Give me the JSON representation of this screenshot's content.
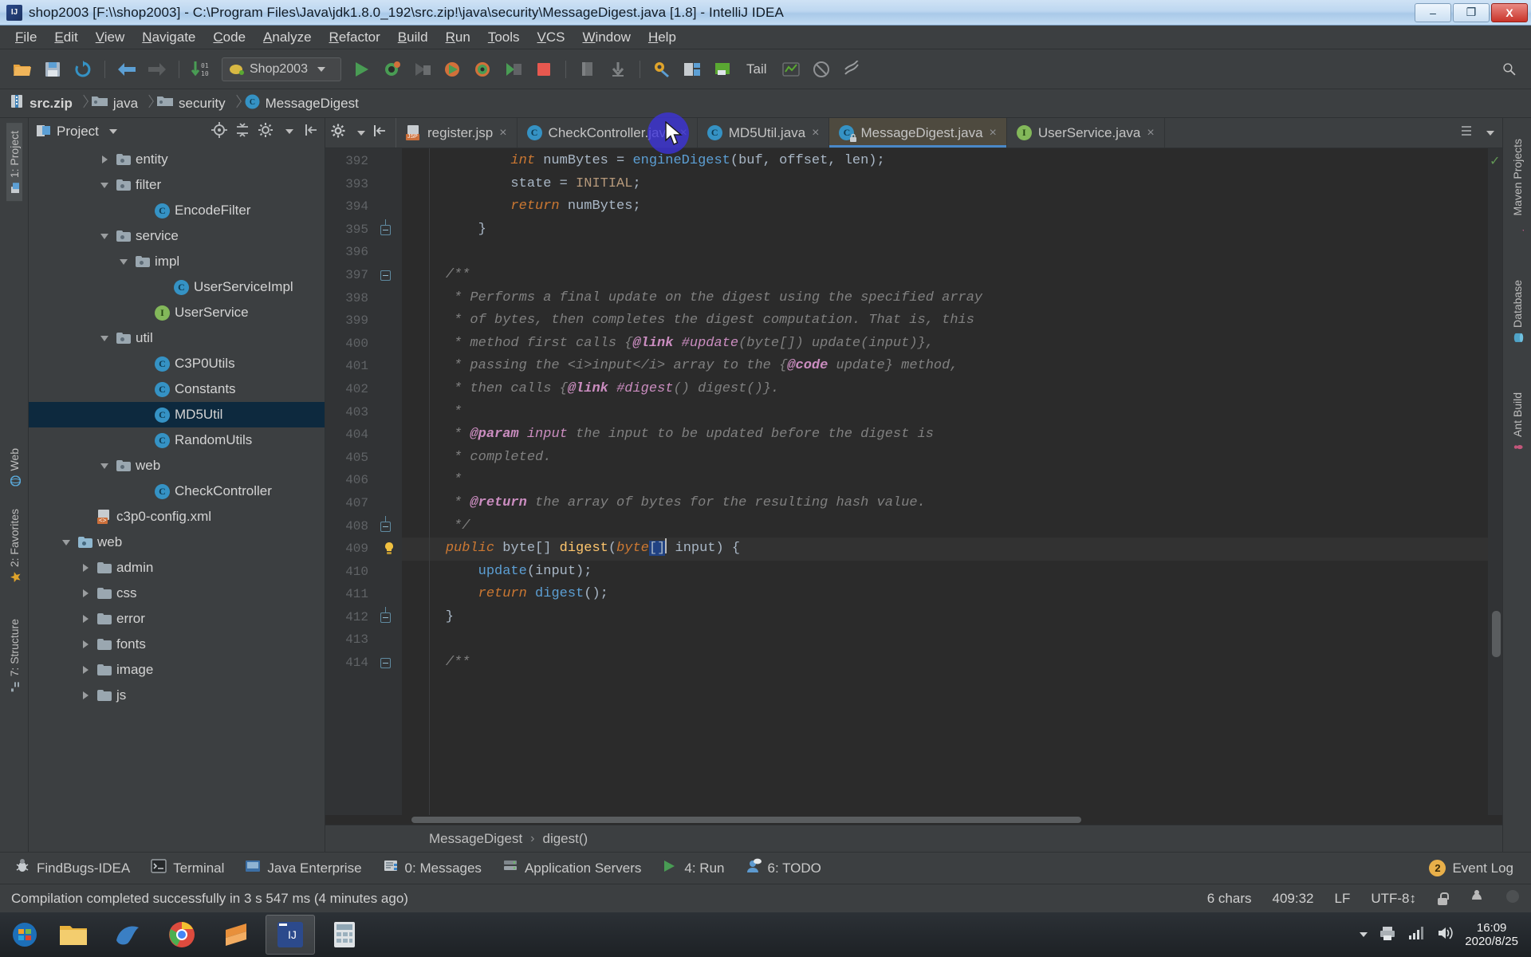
{
  "window": {
    "title": "shop2003 [F:\\\\shop2003] - C:\\Program Files\\Java\\jdk1.8.0_192\\src.zip!\\java\\security\\MessageDigest.java [1.8] - IntelliJ IDEA",
    "minimize_label": "–",
    "maximize_label": "❐",
    "close_label": "X"
  },
  "menubar": {
    "items": [
      {
        "label": "File",
        "mnemonic": "F"
      },
      {
        "label": "Edit",
        "mnemonic": "E"
      },
      {
        "label": "View",
        "mnemonic": "V"
      },
      {
        "label": "Navigate",
        "mnemonic": "N"
      },
      {
        "label": "Code",
        "mnemonic": "C"
      },
      {
        "label": "Analyze",
        "mnemonic": "A"
      },
      {
        "label": "Refactor",
        "mnemonic": "R"
      },
      {
        "label": "Build",
        "mnemonic": "B"
      },
      {
        "label": "Run",
        "mnemonic": "R"
      },
      {
        "label": "Tools",
        "mnemonic": "T"
      },
      {
        "label": "VCS",
        "mnemonic": "V"
      },
      {
        "label": "Window",
        "mnemonic": "W"
      },
      {
        "label": "Help",
        "mnemonic": "H"
      }
    ]
  },
  "toolbar": {
    "run_config": "Shop2003",
    "tail_label": "Tail",
    "icons": [
      "open-project-icon",
      "save-all-icon",
      "sync-icon",
      "back-icon",
      "forward-icon",
      "compile-icon",
      "run-icon",
      "debug-icon",
      "run-with-coverage-icon",
      "profile-run-icon",
      "profile-debug-icon",
      "run-tests-icon",
      "stop-icon",
      "deploy-icon",
      "update-app-icon",
      "settings-icon",
      "project-structure-icon",
      "database-icon"
    ],
    "search_icon": "search-icon"
  },
  "breadcrumb": {
    "items": [
      {
        "label": "src.zip",
        "icon": "zip-file-icon"
      },
      {
        "label": "java",
        "icon": "folder-icon"
      },
      {
        "label": "security",
        "icon": "folder-icon"
      },
      {
        "label": "MessageDigest",
        "icon": "class-icon"
      }
    ]
  },
  "left_strip": {
    "items": [
      {
        "label": "1: Project",
        "icon": "project-icon",
        "active": true
      },
      {
        "label": "Web",
        "icon": "web-icon",
        "active": false
      },
      {
        "label": "2: Favorites",
        "icon": "star-icon",
        "active": false
      },
      {
        "label": "7: Structure",
        "icon": "structure-icon",
        "active": false
      }
    ]
  },
  "right_strip": {
    "items": [
      {
        "label": "Maven Projects",
        "icon": "maven-icon"
      },
      {
        "label": "Database",
        "icon": "database-icon"
      },
      {
        "label": "Ant Build",
        "icon": "ant-icon"
      }
    ]
  },
  "project_panel": {
    "title": "Project",
    "dropdown_icon": "chevron-down-icon",
    "toolbar_icons": [
      "locate-icon",
      "collapse-all-icon",
      "gear-icon",
      "hide-icon"
    ],
    "tree": [
      {
        "label": "entity",
        "indent": 3,
        "arrow": "closed",
        "icon": "folder",
        "selected": false
      },
      {
        "label": "filter",
        "indent": 3,
        "arrow": "open",
        "icon": "folder",
        "selected": false
      },
      {
        "label": "EncodeFilter",
        "indent": 5,
        "arrow": "none",
        "icon": "class",
        "selected": false
      },
      {
        "label": "service",
        "indent": 3,
        "arrow": "open",
        "icon": "folder",
        "selected": false
      },
      {
        "label": "impl",
        "indent": 4,
        "arrow": "open",
        "icon": "folder",
        "selected": false
      },
      {
        "label": "UserServiceImpl",
        "indent": 6,
        "arrow": "none",
        "icon": "class",
        "selected": false
      },
      {
        "label": "UserService",
        "indent": 5,
        "arrow": "none",
        "icon": "interface",
        "selected": false
      },
      {
        "label": "util",
        "indent": 3,
        "arrow": "open",
        "icon": "folder",
        "selected": false
      },
      {
        "label": "C3P0Utils",
        "indent": 5,
        "arrow": "none",
        "icon": "class",
        "selected": false
      },
      {
        "label": "Constants",
        "indent": 5,
        "arrow": "none",
        "icon": "class",
        "selected": false
      },
      {
        "label": "MD5Util",
        "indent": 5,
        "arrow": "none",
        "icon": "class",
        "selected": true
      },
      {
        "label": "RandomUtils",
        "indent": 5,
        "arrow": "none",
        "icon": "class",
        "selected": false
      },
      {
        "label": "web",
        "indent": 3,
        "arrow": "open",
        "icon": "folder",
        "selected": false
      },
      {
        "label": "CheckController",
        "indent": 5,
        "arrow": "none",
        "icon": "class",
        "selected": false
      },
      {
        "label": "c3p0-config.xml",
        "indent": 2,
        "arrow": "none",
        "icon": "xml",
        "selected": false
      },
      {
        "label": "web",
        "indent": 1,
        "arrow": "open",
        "icon": "folder-blue",
        "selected": false
      },
      {
        "label": "admin",
        "indent": 2,
        "arrow": "closed",
        "icon": "folder-plain",
        "selected": false
      },
      {
        "label": "css",
        "indent": 2,
        "arrow": "closed",
        "icon": "folder-plain",
        "selected": false
      },
      {
        "label": "error",
        "indent": 2,
        "arrow": "closed",
        "icon": "folder-plain",
        "selected": false
      },
      {
        "label": "fonts",
        "indent": 2,
        "arrow": "closed",
        "icon": "folder-plain",
        "selected": false
      },
      {
        "label": "image",
        "indent": 2,
        "arrow": "closed",
        "icon": "folder-plain",
        "selected": false
      },
      {
        "label": "js",
        "indent": 2,
        "arrow": "closed",
        "icon": "folder-plain",
        "selected": false
      }
    ]
  },
  "editor": {
    "tabs": [
      {
        "label": "register.jsp",
        "icon": "jsp-file-icon",
        "active": false,
        "close": "×"
      },
      {
        "label": "CheckController.java",
        "icon": "class-icon",
        "active": false,
        "close": "×"
      },
      {
        "label": "MD5Util.java",
        "icon": "class-icon",
        "active": false,
        "close": "×"
      },
      {
        "label": "MessageDigest.java",
        "icon": "class-locked-icon",
        "active": true,
        "close": "×"
      },
      {
        "label": "UserService.java",
        "icon": "interface-icon",
        "active": false,
        "close": "×"
      }
    ],
    "tab_tools": [
      "gear-icon",
      "hide-tabs-icon"
    ],
    "tabs_right_icons": [
      "list-icon"
    ],
    "lines": [
      {
        "num": 392,
        "fold": "",
        "html": "            <span class='k'>int</span> numBytes = <span class='call'>engineDigest</span>(buf, offset, len);"
      },
      {
        "num": 393,
        "fold": "",
        "html": "            state = <span class='const'>INITIAL</span>;"
      },
      {
        "num": 394,
        "fold": "",
        "html": "            <span class='k'>return</span> numBytes;"
      },
      {
        "num": 395,
        "fold": "minus bot",
        "html": "        }"
      },
      {
        "num": 396,
        "fold": "",
        "html": ""
      },
      {
        "num": 397,
        "fold": "minus",
        "html": "    <span class='cmt'>/**</span>"
      },
      {
        "num": 398,
        "fold": "",
        "html": "     <span class='cmt'>* Performs a final update on the digest using the specified array</span>"
      },
      {
        "num": 399,
        "fold": "",
        "html": "     <span class='cmt'>* of bytes, then completes the digest computation. That is, this</span>"
      },
      {
        "num": 400,
        "fold": "",
        "html": "     <span class='cmt'>* method first calls {</span><span class='doctag'>@link</span><span class='cmt'> </span><span class='docparam'>#update</span><span class='cmt'>(byte[]) update(input)},</span>"
      },
      {
        "num": 401,
        "fold": "",
        "html": "     <span class='cmt'>* passing the &lt;i&gt;input&lt;/i&gt; array to the {</span><span class='doctag'>@code</span><span class='cmt'> update} method,</span>"
      },
      {
        "num": 402,
        "fold": "",
        "html": "     <span class='cmt'>* then calls {</span><span class='doctag'>@link</span><span class='cmt'> </span><span class='docparam'>#digest</span><span class='cmt'>() digest()}.</span>"
      },
      {
        "num": 403,
        "fold": "",
        "html": "     <span class='cmt'>*</span>"
      },
      {
        "num": 404,
        "fold": "",
        "html": "     <span class='cmt'>* </span><span class='doctag'>@param</span><span class='cmt'> </span><span class='docparam'>input</span><span class='cmt'> the input to be updated before the digest is</span>"
      },
      {
        "num": 405,
        "fold": "",
        "html": "     <span class='cmt'>* completed.</span>"
      },
      {
        "num": 406,
        "fold": "",
        "html": "     <span class='cmt'>*</span>"
      },
      {
        "num": 407,
        "fold": "",
        "html": "     <span class='cmt'>* </span><span class='doctag'>@return</span><span class='cmt'> the array of bytes for the resulting hash value.</span>"
      },
      {
        "num": 408,
        "fold": "minus bot",
        "html": "     <span class='cmt'>*/</span>"
      },
      {
        "num": 409,
        "fold": "",
        "highlight": true,
        "bulb": true,
        "html": "    <span class='k'>public</span> <span class='ident'>byte</span>[] <span class='mth'>digest</span>(<span class='k'>byte</span><span class='sel'>[]</span><span class='caret-bar'></span> input) {"
      },
      {
        "num": 410,
        "fold": "",
        "html": "        <span class='call'>update</span>(input);"
      },
      {
        "num": 411,
        "fold": "",
        "html": "        <span class='k'>return</span> <span class='call'>digest</span>();"
      },
      {
        "num": 412,
        "fold": "minus bot",
        "html": "    }"
      },
      {
        "num": 413,
        "fold": "",
        "html": ""
      },
      {
        "num": 414,
        "fold": "minus",
        "html": "    <span class='cmt'>/**</span>"
      }
    ],
    "breadcrumb_bottom": [
      "MessageDigest",
      "digest()"
    ],
    "breadcrumb_sep": "›",
    "inspection_status": "ok-check-icon"
  },
  "bottom_bar": {
    "items": [
      {
        "label": "FindBugs-IDEA",
        "icon": "findbugs-icon",
        "mnemonic": ""
      },
      {
        "label": "Terminal",
        "icon": "terminal-icon",
        "mnemonic": ""
      },
      {
        "label": "Java Enterprise",
        "icon": "java-ee-icon",
        "mnemonic": ""
      },
      {
        "label": "0: Messages",
        "icon": "messages-icon",
        "mnemonic": "0"
      },
      {
        "label": "Application Servers",
        "icon": "app-servers-icon",
        "mnemonic": ""
      },
      {
        "label": "4: Run",
        "icon": "run-icon",
        "mnemonic": "4"
      },
      {
        "label": "6: TODO",
        "icon": "todo-icon",
        "mnemonic": "6"
      }
    ],
    "event_log": {
      "label": "Event Log",
      "badge": "2"
    }
  },
  "status_bar": {
    "message": "Compilation completed successfully in 3 s 547 ms (4 minutes ago)",
    "chars": "6 chars",
    "caret_position": "409:32",
    "line_separator": "LF",
    "encoding": "UTF-8",
    "encoding_arrows": "↕",
    "lock_icon": "lock-icon",
    "inspection_icon": "inspection-profile-icon"
  },
  "taskbar": {
    "start_icon": "windows-start-icon",
    "apps": [
      {
        "name": "file-explorer-icon",
        "active": false
      },
      {
        "name": "browser-dolphin-icon",
        "active": false
      },
      {
        "name": "chrome-icon",
        "active": false
      },
      {
        "name": "sublime-text-icon",
        "active": false
      },
      {
        "name": "intellij-idea-icon",
        "active": true
      },
      {
        "name": "calculator-icon",
        "active": false
      }
    ],
    "tray_icons": [
      "show-hidden-icon",
      "printer-icon",
      "network-icon",
      "volume-icon"
    ],
    "clock_time": "16:09",
    "clock_date": "2020/8/25"
  }
}
